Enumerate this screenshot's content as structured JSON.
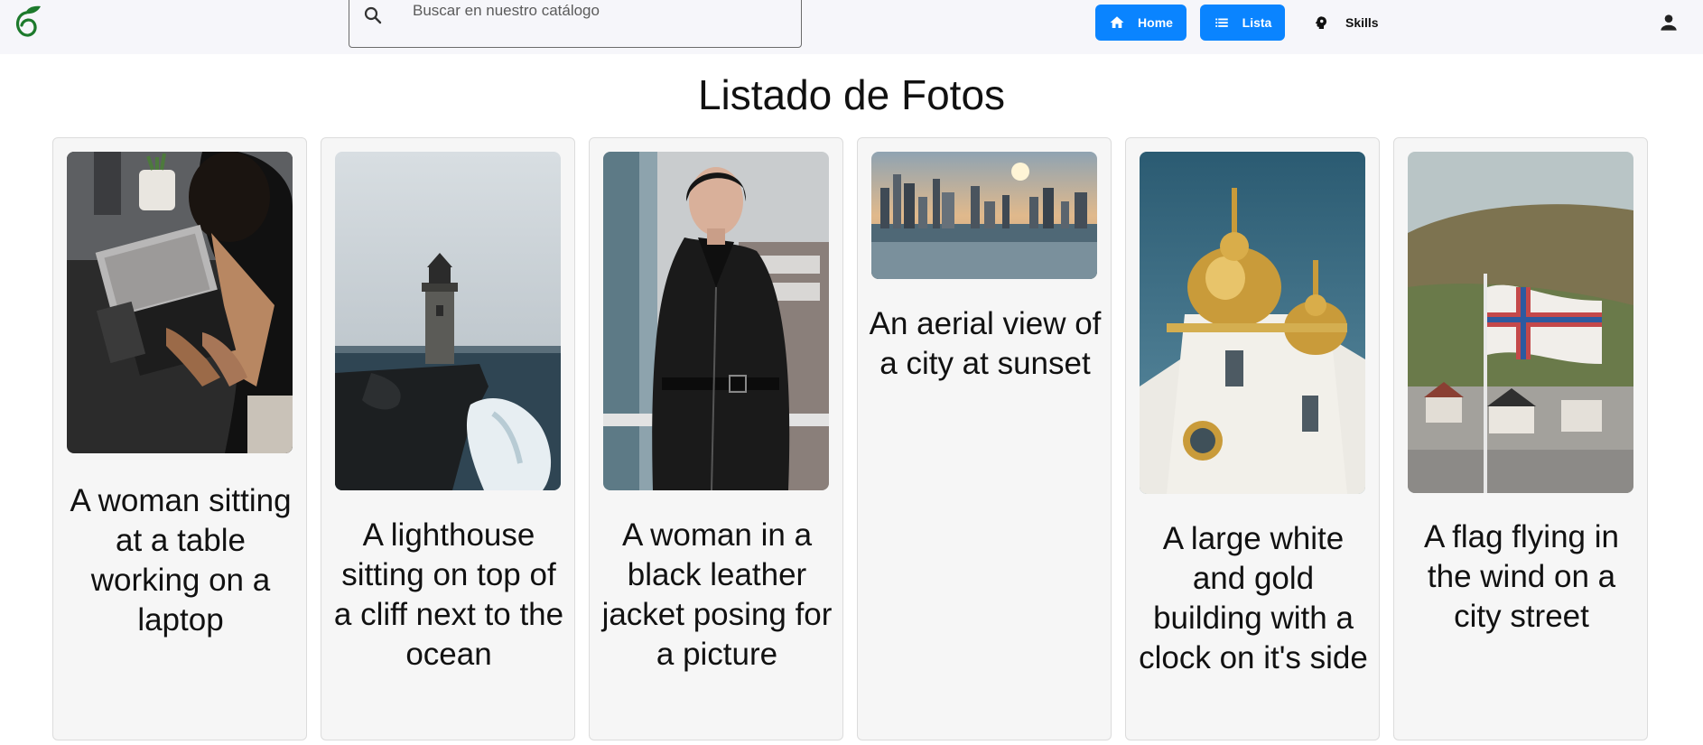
{
  "header": {
    "logo_icon": "leaf-logo-icon",
    "search": {
      "placeholder": "Buscar en nuestro catálogo",
      "value": "",
      "icon": "search-icon"
    },
    "nav": {
      "home": {
        "label": "Home",
        "icon": "home-icon"
      },
      "lista": {
        "label": "Lista",
        "icon": "list-icon"
      },
      "skills": {
        "label": "Skills",
        "icon": "psychology-icon"
      }
    },
    "account_icon": "person-icon",
    "accent_color": "#0a84ff"
  },
  "main": {
    "title": "Listado de Fotos",
    "cards": [
      {
        "caption": "A woman sitting at a table working on a laptop"
      },
      {
        "caption": "A lighthouse sitting on top of a cliff next to the ocean"
      },
      {
        "caption": "A woman in a black leather jacket posing for a picture"
      },
      {
        "caption": "An aerial view of a city at sunset"
      },
      {
        "caption": "A large white and gold building with a clock on it's side"
      },
      {
        "caption": "A flag flying in the wind on a city street"
      }
    ]
  }
}
